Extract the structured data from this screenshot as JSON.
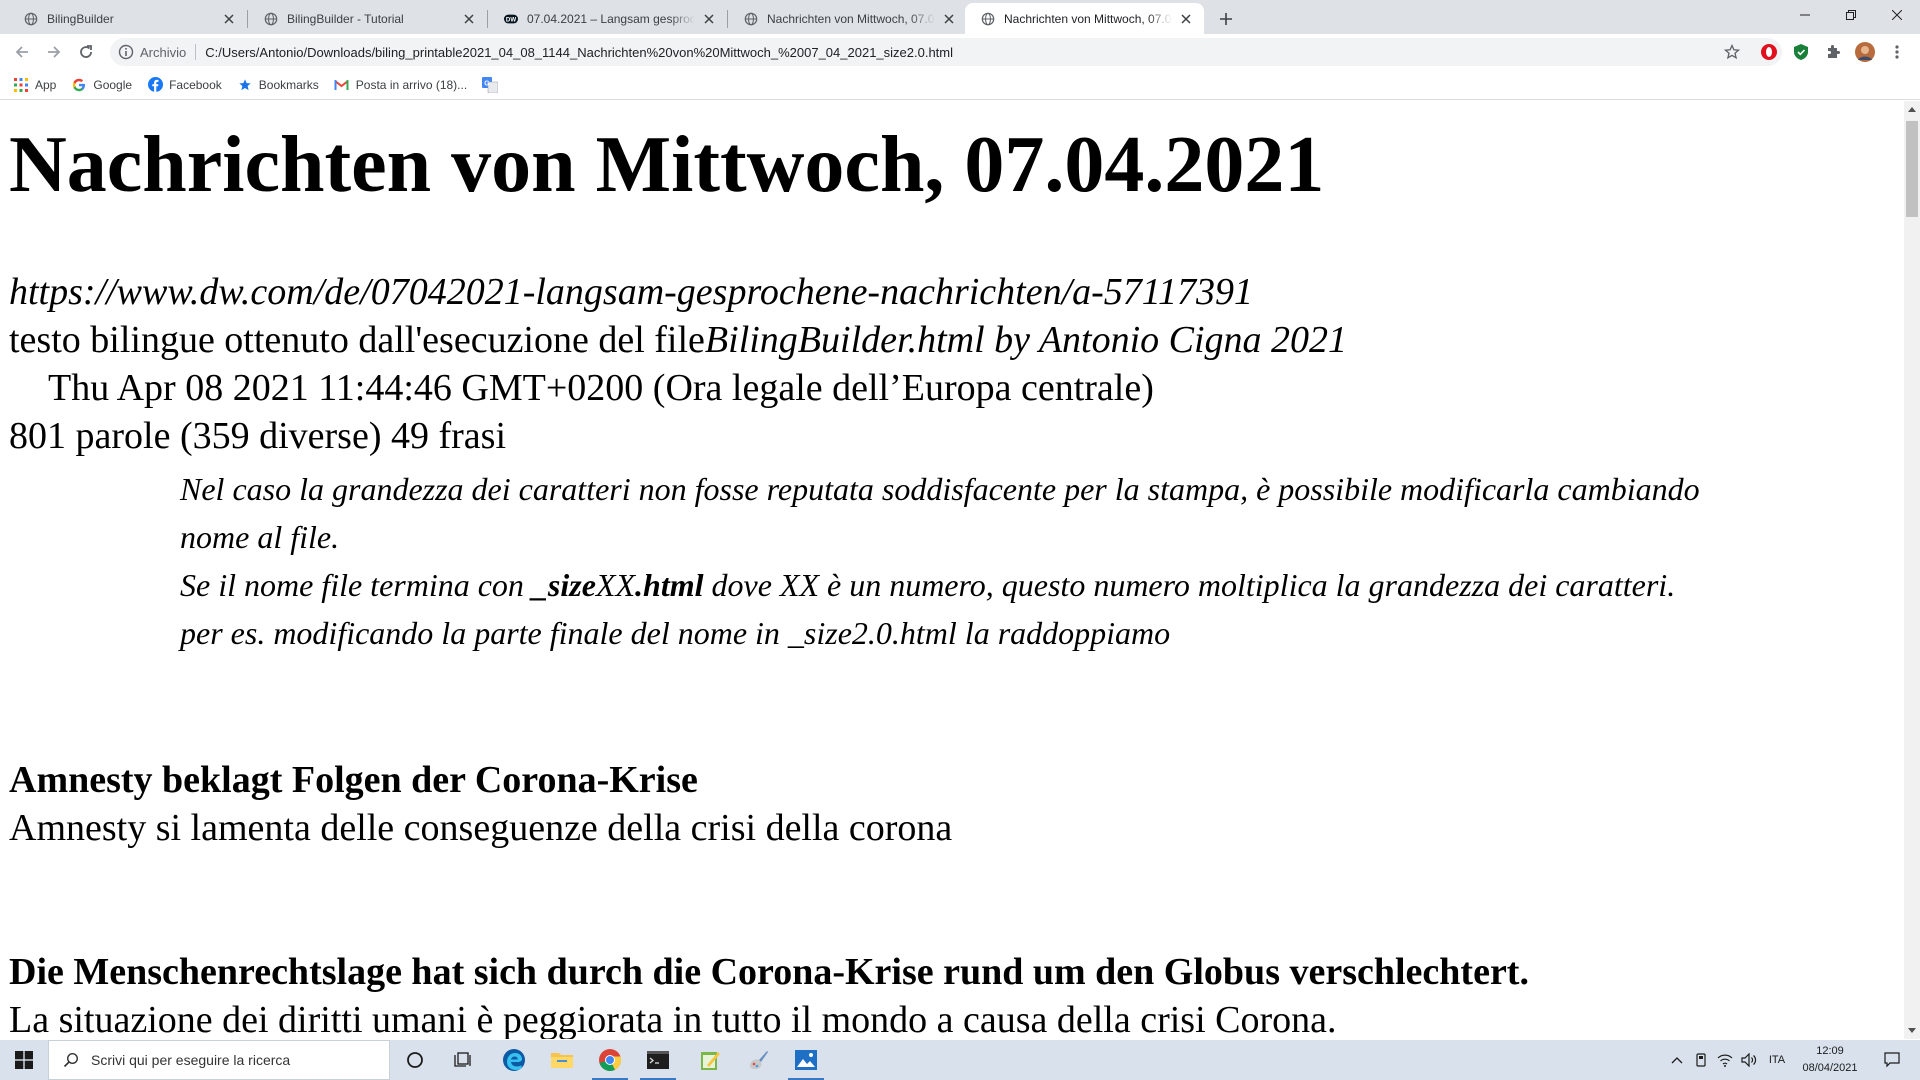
{
  "browser": {
    "tabs": [
      {
        "title": "BilingBuilder",
        "active": false
      },
      {
        "title": "BilingBuilder - Tutorial",
        "active": false
      },
      {
        "title": "07.04.2021 – Langsam gesproche",
        "active": false
      },
      {
        "title": "Nachrichten von Mittwoch, 07.04.",
        "active": false
      },
      {
        "title": "Nachrichten von Mittwoch, 07.04.",
        "active": true
      }
    ],
    "address": {
      "chip": "Archivio",
      "url": "C:/Users/Antonio/Downloads/biling_printable2021_04_08_1144_Nachrichten%20von%20Mittwoch_%2007_04_2021_size2.0.html"
    },
    "bookmarks": [
      {
        "label": "App",
        "icon": "apps-grid-icon"
      },
      {
        "label": "Google",
        "icon": "google-icon"
      },
      {
        "label": "Facebook",
        "icon": "facebook-icon"
      },
      {
        "label": "Bookmarks",
        "icon": "star-icon"
      },
      {
        "label": "Posta in arrivo (18)...",
        "icon": "gmail-icon"
      },
      {
        "label": "",
        "icon": "translate-icon"
      }
    ]
  },
  "page": {
    "title": "Nachrichten von Mittwoch, 07.04.2021",
    "source_url": "https://www.dw.com/de/07042021-langsam-gesprochene-nachrichten/a-57117391",
    "generated_prefix": "testo bilingue ottenuto dall'esecuzione del file",
    "generated_italic": "BilingBuilder.html by Antonio Cigna 2021",
    "date_line": "Thu Apr 08 2021 11:44:46 GMT+0200 (Ora legale dell’Europa centrale)",
    "stats": "801 parole (359 diverse) 49 frasi",
    "note": {
      "line1": "Nel caso la grandezza dei caratteri non fosse reputata soddisfacente per la stampa, è possibile modificarla cambiando",
      "line2": "nome al file.",
      "line3_before": "Se il nome file termina con ",
      "line3_bold1": "_size",
      "line3_mid": "XX",
      "line3_bold2": ".html",
      "line3_after": " dove XX è un numero, questo numero moltiplica la grandezza dei caratteri.",
      "line4": "per es. modificando la parte finale del nome in _size2.0.html la raddoppiamo"
    },
    "sentences": [
      {
        "de": "Amnesty beklagt Folgen der Corona-Krise",
        "it": "Amnesty si lamenta delle conseguenze della crisi della corona"
      },
      {
        "de": "Die Menschenrechtslage hat sich durch die Corona-Krise rund um den Globus verschlechtert.",
        "it": "La situazione dei diritti umani è peggiorata in tutto il mondo a causa della crisi Corona."
      }
    ]
  },
  "taskbar": {
    "search_placeholder": "Scrivi qui per eseguire la ricerca",
    "language": "ITA",
    "time": "12:09",
    "date": "08/04/2021"
  },
  "colors": {
    "tabstrip_bg": "#dee1e6",
    "omnibox_bg": "#f1f3f4",
    "taskbar_bg": "#d9e2ec",
    "accent_blue": "#1a73e8"
  }
}
